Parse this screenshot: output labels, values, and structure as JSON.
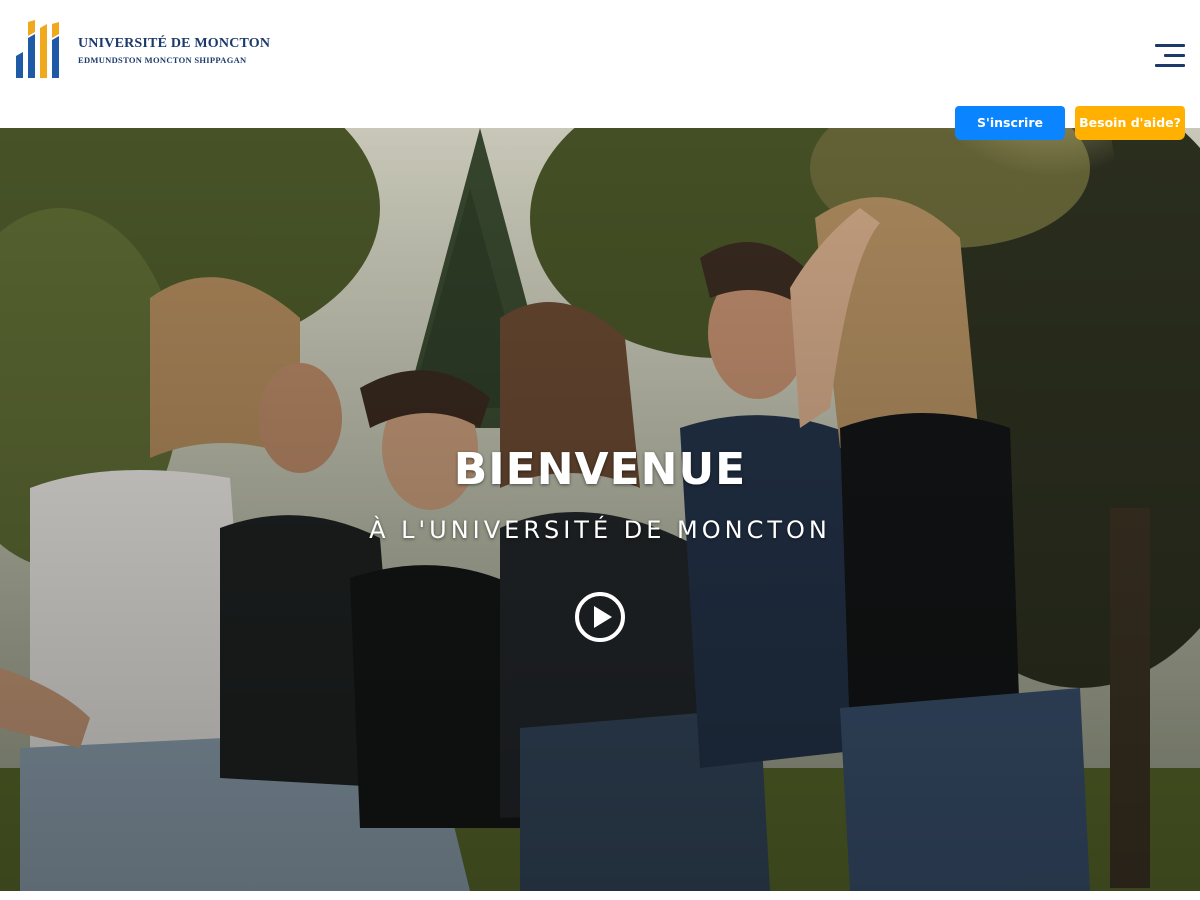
{
  "header": {
    "logo": {
      "name": "UNIVERSITÉ DE MONCTON",
      "campuses": "EDMUNDSTON  MONCTON  SHIPPAGAN",
      "colors": {
        "navy": "#1b3a6b",
        "gold": "#f0a81c",
        "blue": "#1f5aa6"
      }
    },
    "menu_icon": "hamburger-menu-icon"
  },
  "cta": {
    "register_label": "S'inscrire",
    "help_label": "Besoin d'aide?",
    "register_color": "#0a84ff",
    "help_color": "#ffb000"
  },
  "hero": {
    "title": "BIENVENUE",
    "subtitle": "À L'UNIVERSITÉ DE MONCTON",
    "play_icon": "play-circle-icon"
  }
}
